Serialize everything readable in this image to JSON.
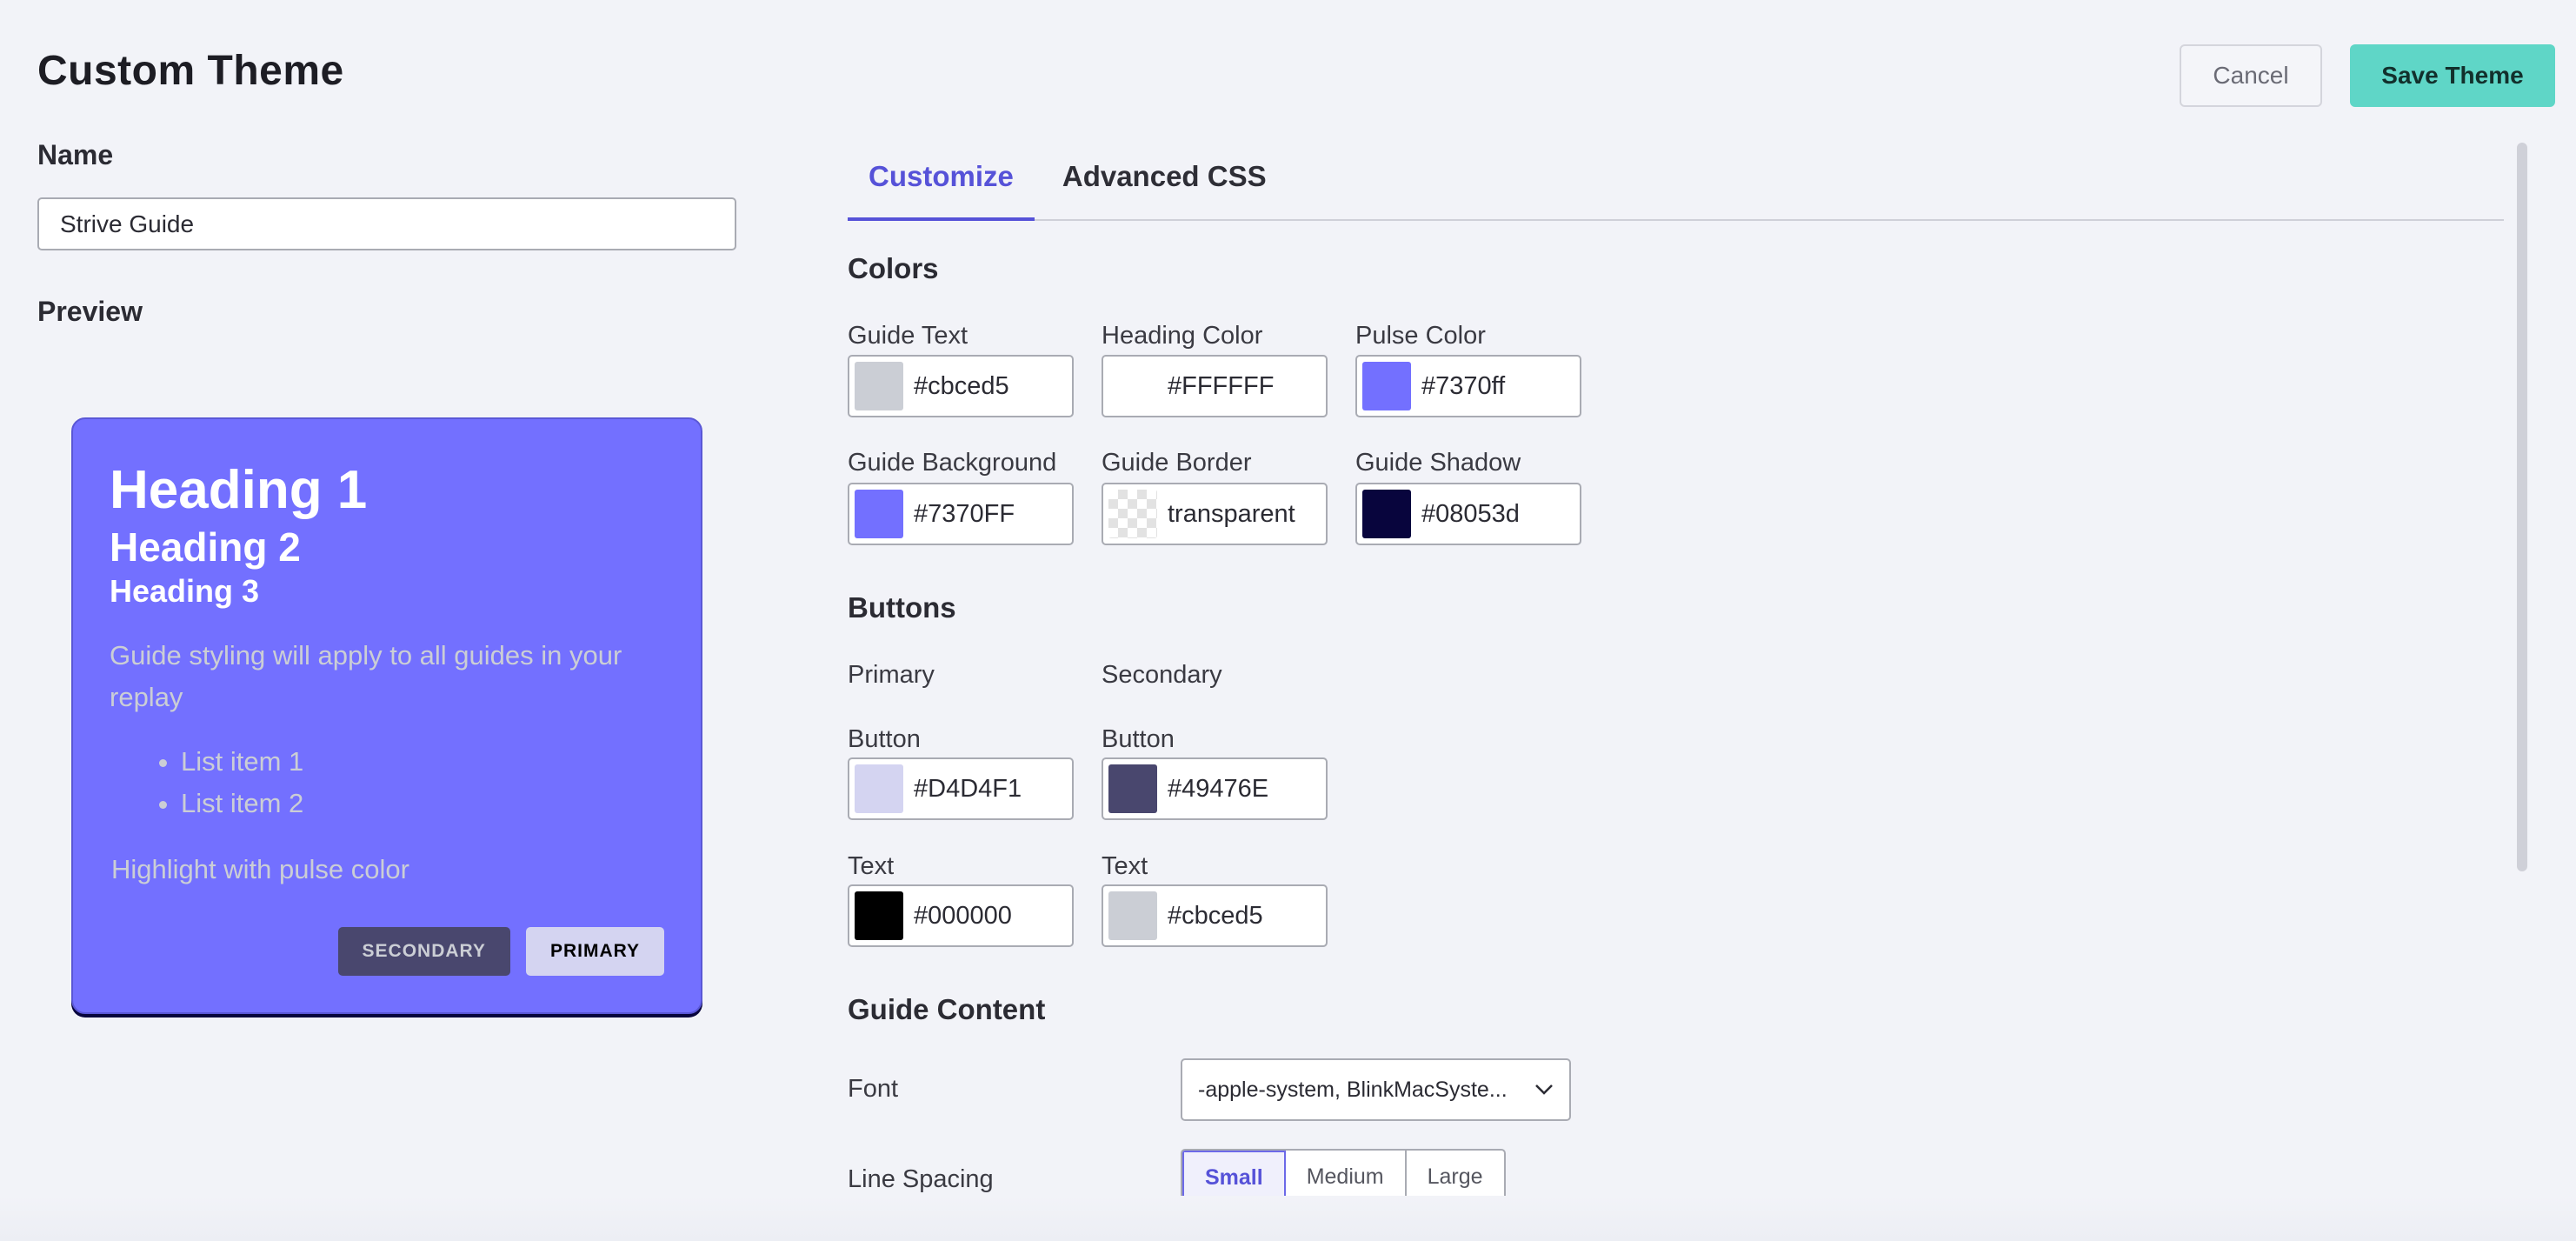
{
  "header": {
    "title": "Custom Theme",
    "cancel_label": "Cancel",
    "save_label": "Save Theme"
  },
  "left": {
    "name_label": "Name",
    "name_value": "Strive Guide",
    "preview_label": "Preview",
    "preview": {
      "heading1": "Heading 1",
      "heading2": "Heading 2",
      "heading3": "Heading 3",
      "body": "Guide styling will apply to all guides in your replay",
      "list_items": [
        "List item 1",
        "List item 2"
      ],
      "highlight": "Highlight with pulse color",
      "secondary_button": "SECONDARY",
      "primary_button": "PRIMARY"
    }
  },
  "tabs": [
    {
      "label": "Customize",
      "active": true
    },
    {
      "label": "Advanced CSS",
      "active": false
    }
  ],
  "colors": {
    "section_title": "Colors",
    "fields": [
      {
        "label": "Guide Text",
        "value": "#cbced5",
        "swatch": "#cbced5"
      },
      {
        "label": "Heading Color",
        "value": "#FFFFFF",
        "swatch": "#FFFFFF"
      },
      {
        "label": "Pulse Color",
        "value": "#7370ff",
        "swatch": "#7370ff"
      },
      {
        "label": "Guide Background",
        "value": "#7370FF",
        "swatch": "#7370FF"
      },
      {
        "label": "Guide Border",
        "value": "transparent",
        "swatch": "transparent"
      },
      {
        "label": "Guide Shadow",
        "value": "#08053d",
        "swatch": "#08053d"
      }
    ]
  },
  "buttons": {
    "section_title": "Buttons",
    "primary_label": "Primary",
    "secondary_label": "Secondary",
    "fields": [
      {
        "label": "Button",
        "value": "#D4D4F1",
        "swatch": "#D4D4F1"
      },
      {
        "label": "Button",
        "value": "#49476E",
        "swatch": "#49476E"
      },
      {
        "label": "Text",
        "value": "#000000",
        "swatch": "#000000"
      },
      {
        "label": "Text",
        "value": "#cbced5",
        "swatch": "#cbced5"
      }
    ]
  },
  "guide_content": {
    "section_title": "Guide Content",
    "font_label": "Font",
    "font_value": "-apple-system, BlinkMacSyste...",
    "line_spacing_label": "Line Spacing",
    "line_spacing_options": [
      "Small",
      "Medium",
      "Large"
    ],
    "line_spacing_selected": "Small"
  },
  "theme_colors": {
    "accent": "#5652d8",
    "save_button": "#5fd6c7",
    "preview_bg": "#7370ff"
  }
}
